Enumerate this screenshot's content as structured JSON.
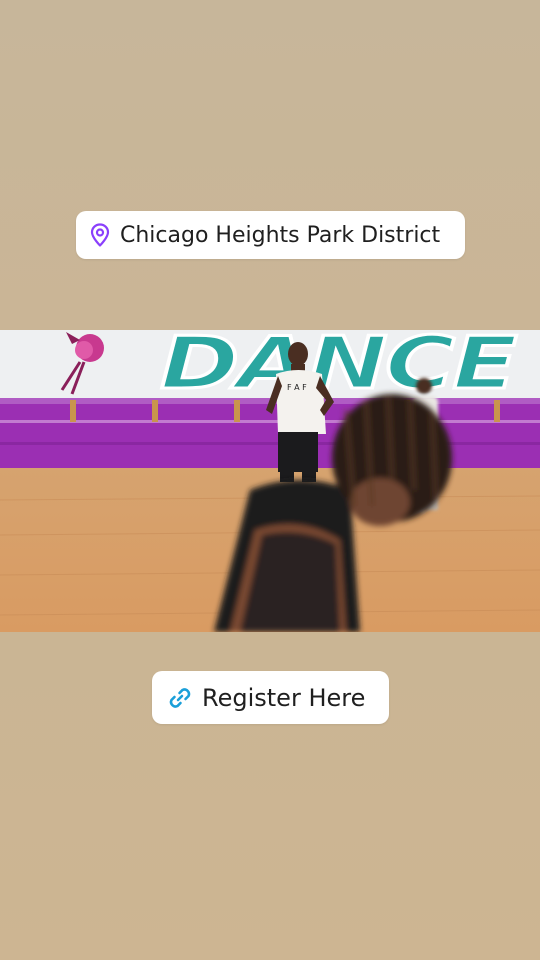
{
  "location_sticker": {
    "label": "Chicago Heights Park District",
    "icon": "location-pin-icon",
    "icon_color": "#8a3ffc"
  },
  "video": {
    "wall_text": "DANCE",
    "shirt_text": "F A F"
  },
  "link_sticker": {
    "label": "Register Here",
    "icon": "link-icon",
    "icon_color": "#1a9fd9"
  },
  "colors": {
    "background": "#c9b594",
    "sticker_bg": "#ffffff",
    "wall_purple": "#9b2fb3",
    "dance_teal": "#2aa6a0",
    "floor": "#d9a06a"
  }
}
